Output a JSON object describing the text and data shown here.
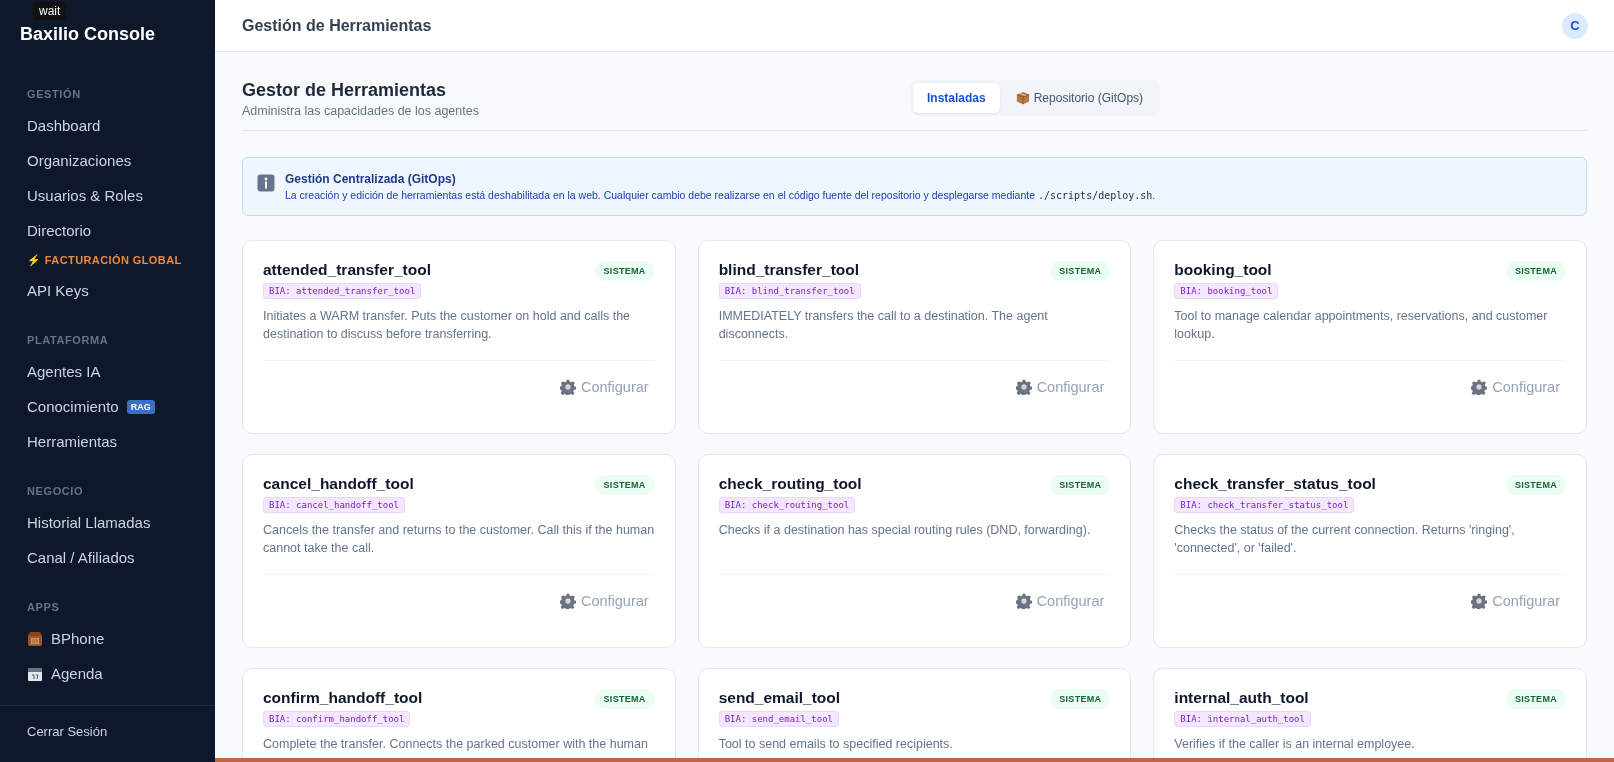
{
  "tooltip": "wait",
  "sidebar": {
    "logo": "Baxilio Console",
    "groups": [
      {
        "title": "GESTIÓN",
        "items": [
          {
            "label": "Dashboard",
            "kind": "link"
          },
          {
            "label": "Organizaciones",
            "kind": "link"
          },
          {
            "label": "Usuarios & Roles",
            "kind": "link"
          },
          {
            "label": "Directorio",
            "kind": "link"
          },
          {
            "label": "⚡ FACTURACIÓN GLOBAL",
            "kind": "highlight"
          },
          {
            "label": "API Keys",
            "kind": "link"
          }
        ]
      },
      {
        "title": "PLATAFORMA",
        "items": [
          {
            "label": "Agentes IA",
            "kind": "link"
          },
          {
            "label": "Conocimiento",
            "kind": "link",
            "badge": "RAG"
          },
          {
            "label": "Herramientas",
            "kind": "link"
          }
        ]
      },
      {
        "title": "NEGOCIO",
        "items": [
          {
            "label": "Historial Llamadas",
            "kind": "link"
          },
          {
            "label": "Canal / Afiliados",
            "kind": "link"
          }
        ]
      },
      {
        "title": "APPS",
        "items": [
          {
            "label": "BPhone",
            "kind": "phone"
          },
          {
            "label": "Agenda",
            "kind": "calendar"
          }
        ]
      }
    ],
    "logout": "Cerrar Sesión"
  },
  "header": {
    "title": "Gestión de Herramientas",
    "avatar": "C"
  },
  "page": {
    "title": "Gestor de Herramientas",
    "subtitle": "Administra las capacidades de los agentes",
    "tabs": [
      {
        "label": "Instaladas",
        "selected": true,
        "kind": "plain"
      },
      {
        "label": "Repositorio (GitOps)",
        "selected": false,
        "kind": "box"
      }
    ]
  },
  "notice": {
    "title": "Gestión Centralizada (GitOps)",
    "text": "La creación y edición de herramientas está deshabilitada en la web. Cualquier cambio debe realizarse en el código fuente del repositorio y desplegarse mediante ",
    "code": "./scripts/deploy.sh",
    "end": "."
  },
  "tools": [
    {
      "name": "attended_transfer_tool",
      "badge": "SISTEMA",
      "id": "BIA: attended_transfer_tool",
      "description": "Initiates a WARM transfer. Puts the customer on hold and calls the destination to discuss before transferring.",
      "action": "Configurar"
    },
    {
      "name": "blind_transfer_tool",
      "badge": "SISTEMA",
      "id": "BIA: blind_transfer_tool",
      "description": "IMMEDIATELY transfers the call to a destination. The agent disconnects.",
      "action": "Configurar"
    },
    {
      "name": "booking_tool",
      "badge": "SISTEMA",
      "id": "BIA: booking_tool",
      "description": "Tool to manage calendar appointments, reservations, and customer lookup.",
      "action": "Configurar"
    },
    {
      "name": "cancel_handoff_tool",
      "badge": "SISTEMA",
      "id": "BIA: cancel_handoff_tool",
      "description": "Cancels the transfer and returns to the customer. Call this if the human cannot take the call.",
      "action": "Configurar"
    },
    {
      "name": "check_routing_tool",
      "badge": "SISTEMA",
      "id": "BIA: check_routing_tool",
      "description": "Checks if a destination has special routing rules (DND, forwarding).",
      "action": "Configurar"
    },
    {
      "name": "check_transfer_status_tool",
      "badge": "SISTEMA",
      "id": "BIA: check_transfer_status_tool",
      "description": "Checks the status of the current connection. Returns 'ringing', 'connected', or 'failed'.",
      "action": "Configurar"
    },
    {
      "name": "confirm_handoff_tool",
      "badge": "SISTEMA",
      "id": "BIA: confirm_handoff_tool",
      "description": "Complete the transfer. Connects the parked customer with the human"
    },
    {
      "name": "send_email_tool",
      "badge": "SISTEMA",
      "id": "BIA: send_email_tool",
      "description": "Tool to send emails to specified recipients."
    },
    {
      "name": "internal_auth_tool",
      "badge": "SISTEMA",
      "id": "BIA: internal_auth_tool",
      "description": "Verifies if the caller is an internal employee."
    }
  ]
}
